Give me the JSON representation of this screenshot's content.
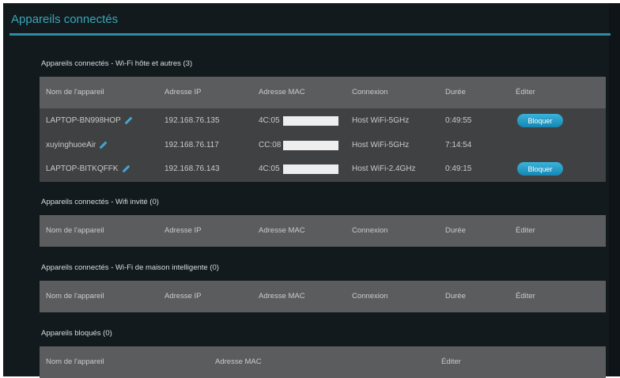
{
  "title": "Appareils connectés",
  "sections": [
    {
      "label": "Appareils connectés - Wi-Fi hôte et autres (3)",
      "headers": [
        "Nom de l'appareil",
        "Adresse IP",
        "Adresse MAC",
        "Connexion",
        "Durée",
        "Éditer"
      ],
      "rows": [
        {
          "name": "LAPTOP-BN998HOP",
          "ip": "192.168.76.135",
          "mac": "4C:05",
          "conn": "Host WiFi-5GHz",
          "dur": "0:49:55",
          "action": "Bloquer"
        },
        {
          "name": "xuyinghuoeAir",
          "ip": "192.168.76.117",
          "mac": "CC:08",
          "conn": "Host WiFi-5GHz",
          "dur": "7:14:54",
          "action": ""
        },
        {
          "name": "LAPTOP-BITKQFFK",
          "ip": "192.168.76.143",
          "mac": "4C:05",
          "conn": "Host WiFi-2.4GHz",
          "dur": "0:49:15",
          "action": "Bloquer"
        }
      ]
    },
    {
      "label": "Appareils connectés - Wifi invité (0)",
      "headers": [
        "Nom de l'appareil",
        "Adresse IP",
        "Adresse MAC",
        "Connexion",
        "Durée",
        "Éditer"
      ]
    },
    {
      "label": "Appareils connectés - Wi-Fi de maison intelligente (0)",
      "headers": [
        "Nom de l'appareil",
        "Adresse IP",
        "Adresse MAC",
        "Connexion",
        "Durée",
        "Éditer"
      ]
    },
    {
      "label": "Appareils bloqués (0)",
      "headers": [
        "Nom de l'appareil",
        "Adresse MAC",
        "Éditer"
      ]
    }
  ]
}
